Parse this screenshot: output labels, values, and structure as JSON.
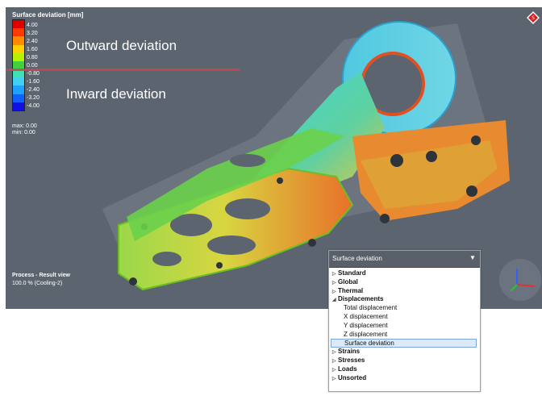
{
  "legend": {
    "title": "Surface deviation [mm]",
    "colors": [
      "#e00000",
      "#ff3a00",
      "#ff8a00",
      "#ffd000",
      "#b8f000",
      "#40d040",
      "#40e0b0",
      "#40d0f0",
      "#20a0ff",
      "#1060ff",
      "#1010e0"
    ],
    "ticks": [
      "4.00",
      "3.20",
      "2.40",
      "1.60",
      "0.80",
      "0.00",
      "-0.80",
      "-1.60",
      "-2.40",
      "-3.20",
      "-4.00"
    ],
    "max_label": "max: 0.00",
    "min_label": "min: 0.00"
  },
  "annotations": {
    "outward": "Outward deviation",
    "inward": "Inward deviation"
  },
  "process": {
    "title": "Process - Result view",
    "status": "100.0 % (Cooling-2)"
  },
  "dropdown": {
    "selected": "Surface deviation",
    "categories": [
      {
        "label": "Standard",
        "expanded": false
      },
      {
        "label": "Global",
        "expanded": false
      },
      {
        "label": "Thermal",
        "expanded": false
      },
      {
        "label": "Displacements",
        "expanded": true,
        "children": [
          "Total displacement",
          "X displacement",
          "Y displacement",
          "Z displacement",
          "Surface deviation"
        ]
      },
      {
        "label": "Strains",
        "expanded": false
      },
      {
        "label": "Stresses",
        "expanded": false
      },
      {
        "label": "Loads",
        "expanded": false
      },
      {
        "label": "Unsorted",
        "expanded": false
      }
    ]
  },
  "icons": {
    "logo": "simufact-logo-icon",
    "axes": "xyz-axes-icon",
    "caret": "chevron-down-icon"
  }
}
